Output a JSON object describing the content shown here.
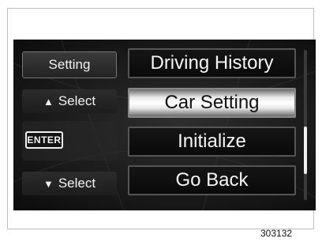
{
  "side_panel": {
    "title": "Setting",
    "select_up_label": "Select",
    "enter_label": "ENTER",
    "select_down_label": "Select"
  },
  "menu": {
    "items": [
      {
        "label": "Driving History",
        "selected": false
      },
      {
        "label": "Car Setting",
        "selected": true
      },
      {
        "label": "Initialize",
        "selected": false
      },
      {
        "label": "Go Back",
        "selected": false
      }
    ]
  },
  "figure_id": "303132",
  "colors": {
    "screen_bg": "#1b1b1b",
    "selected_bg": "#ffffff",
    "text": "#f5f5f5"
  },
  "icons": {
    "up": "triangle-up-icon",
    "down": "triangle-down-icon"
  }
}
